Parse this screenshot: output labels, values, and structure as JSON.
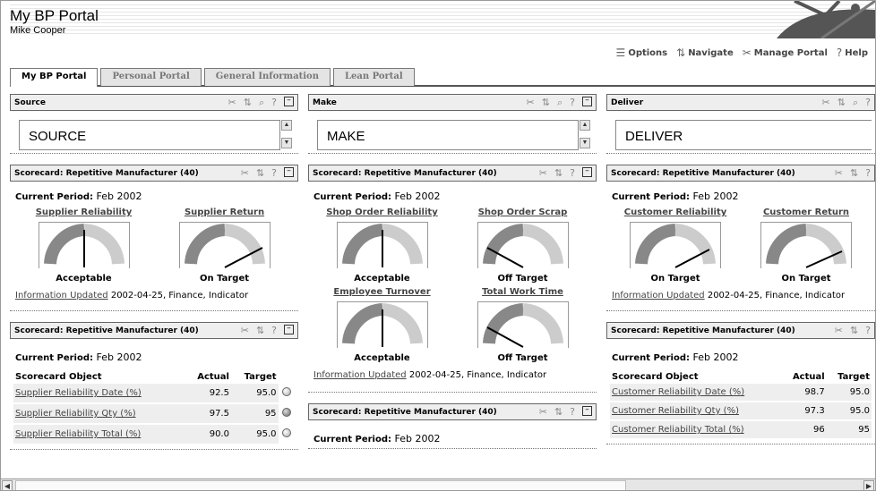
{
  "header": {
    "title": "My BP Portal",
    "user": "Mike Cooper"
  },
  "toplinks": [
    {
      "label": "Options",
      "icon": "options-icon"
    },
    {
      "label": "Navigate",
      "icon": "navigate-icon"
    },
    {
      "label": "Manage Portal",
      "icon": "manage-portal-icon"
    },
    {
      "label": "Help",
      "icon": "help-icon"
    }
  ],
  "tabs": [
    "My BP Portal",
    "Personal Portal",
    "General Information",
    "Lean Portal"
  ],
  "col1": {
    "box_title": "Source",
    "box_text": "SOURCE",
    "sc1": {
      "title": "Scorecard: Repetitive Manufacturer (40)",
      "period_label": "Current Period:",
      "period": "Feb 2002",
      "g1": {
        "label": "Supplier Reliability",
        "status": "Acceptable"
      },
      "g2": {
        "label": "Supplier Return",
        "status": "On Target"
      },
      "upd_link": "Information Updated",
      "upd_text": "2002-04-25, Finance, Indicator"
    },
    "sc2": {
      "title": "Scorecard: Repetitive Manufacturer (40)",
      "period_label": "Current Period:",
      "period": "Feb 2002",
      "h_obj": "Scorecard Object",
      "h_actual": "Actual",
      "h_target": "Target",
      "rows": [
        {
          "name": "Supplier Reliability Date (%)",
          "actual": "92.5",
          "target": "95.0"
        },
        {
          "name": "Supplier Reliability Qty (%)",
          "actual": "97.5",
          "target": "95"
        },
        {
          "name": "Supplier Reliability Total (%)",
          "actual": "90.0",
          "target": "95.0"
        }
      ]
    }
  },
  "col2": {
    "box_title": "Make",
    "box_text": "MAKE",
    "sc1": {
      "title": "Scorecard: Repetitive Manufacturer (40)",
      "period_label": "Current Period:",
      "period": "Feb 2002",
      "g1": {
        "label": "Shop Order Reliability",
        "status": "Acceptable"
      },
      "g2": {
        "label": "Shop Order Scrap",
        "status": "Off Target"
      },
      "g3": {
        "label": "Employee Turnover",
        "status": "Acceptable"
      },
      "g4": {
        "label": "Total Work Time",
        "status": "Off Target"
      },
      "upd_link": "Information Updated",
      "upd_text": "2002-04-25, Finance, Indicator"
    },
    "sc2": {
      "title": "Scorecard: Repetitive Manufacturer (40)",
      "period_label": "Current Period:",
      "period": "Feb 2002"
    }
  },
  "col3": {
    "box_title": "Deliver",
    "box_text": "DELIVER",
    "sc1": {
      "title": "Scorecard: Repetitive Manufacturer (40)",
      "period_label": "Current Period:",
      "period": "Feb 2002",
      "g1": {
        "label": "Customer Reliability",
        "status": "On Target"
      },
      "g2": {
        "label": "Customer Return",
        "status": "On Target"
      },
      "upd_link": "Information Updated",
      "upd_text": "2002-04-25, Finance, Indicator"
    },
    "sc2": {
      "title": "Scorecard: Repetitive Manufacturer (40)",
      "period_label": "Current Period:",
      "period": "Feb 2002",
      "h_obj": "Scorecard Object",
      "h_actual": "Actual",
      "h_target": "Target",
      "rows": [
        {
          "name": "Customer Reliability Date (%)",
          "actual": "98.7",
          "target": "95.0"
        },
        {
          "name": "Customer Reliability Qty (%)",
          "actual": "97.3",
          "target": "95.0"
        },
        {
          "name": "Customer Reliability Total (%)",
          "actual": "96",
          "target": "95"
        }
      ]
    }
  }
}
